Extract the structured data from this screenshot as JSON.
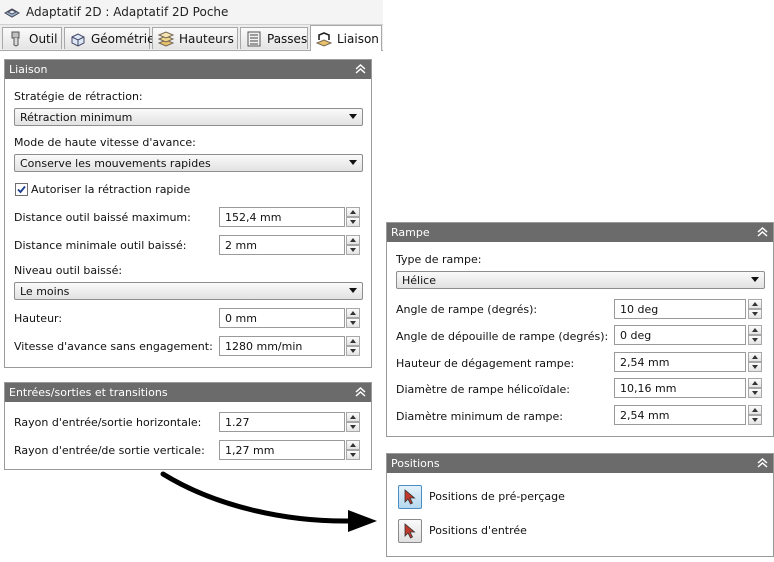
{
  "window": {
    "title": "Adaptatif 2D : Adaptatif 2D Poche"
  },
  "tabs": [
    {
      "label": "Outil",
      "icon": "tool-icon"
    },
    {
      "label": "Géométrie",
      "icon": "geometry-icon"
    },
    {
      "label": "Hauteurs",
      "icon": "heights-icon"
    },
    {
      "label": "Passes",
      "icon": "passes-icon"
    },
    {
      "label": "Liaison",
      "icon": "linking-icon",
      "active": true
    }
  ],
  "liaison": {
    "title": "Liaison",
    "retract_strategy_label": "Stratégie de rétraction:",
    "retract_strategy_value": "Rétraction minimum",
    "high_feed_label": "Mode de haute vitesse d'avance:",
    "high_feed_value": "Conserve les mouvements rapides",
    "rapid_retract_label": "Autoriser la rétraction rapide",
    "rapid_retract_checked": true,
    "max_stay_down_label": "Distance outil baissé maximum:",
    "max_stay_down_value": "152,4 mm",
    "min_stay_down_label": "Distance minimale outil baissé:",
    "min_stay_down_value": "2 mm",
    "keep_down_level_label": "Niveau outil baissé:",
    "keep_down_level_value": "Le moins",
    "height_label": "Hauteur:",
    "height_value": "0 mm",
    "lift_feed_label": "Vitesse d'avance sans engagement:",
    "lift_feed_value": "1280 mm/min"
  },
  "transitions": {
    "title": "Entrées/sorties et transitions",
    "horiz_radius_label": "Rayon d'entrée/sortie horizontale:",
    "horiz_radius_value": "1.27",
    "vert_radius_label": "Rayon d'entrée/de sortie verticale:",
    "vert_radius_value": "1,27 mm"
  },
  "rampe": {
    "title": "Rampe",
    "ramp_type_label": "Type de rampe:",
    "ramp_type_value": "Hélice",
    "ramp_angle_label": "Angle de rampe (degrés):",
    "ramp_angle_value": "10 deg",
    "ramp_taper_label": "Angle de dépouille de rampe (degrés):",
    "ramp_taper_value": "0 deg",
    "ramp_clearance_label": "Hauteur de dégagement rampe:",
    "ramp_clearance_value": "2,54 mm",
    "helix_diameter_label": "Diamètre de rampe hélicoïdale:",
    "helix_diameter_value": "10,16 mm",
    "min_diameter_label": "Diamètre minimum de rampe:",
    "min_diameter_value": "2,54 mm"
  },
  "positions": {
    "title": "Positions",
    "predrill_label": "Positions de pré-perçage",
    "entry_label": "Positions d'entrée"
  },
  "colors": {
    "panel_header": "#6b6b6b",
    "accent_arrow": "#000000",
    "cursor_red": "#c0392b",
    "active_button": "#b6d9f0"
  }
}
